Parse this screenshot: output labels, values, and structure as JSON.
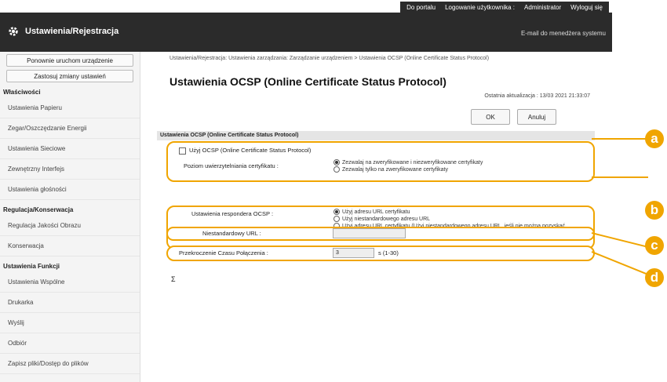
{
  "header": {
    "links": [
      "Do portalu",
      "Logowanie użytkownika :",
      "Administrator",
      "Wyloguj się"
    ],
    "title": "Ustawienia/Rejestracja",
    "mail": "E-mail do menedżera systemu"
  },
  "sidebar": {
    "buttons": [
      "Ponownie uruchom urządzenie",
      "Zastosuj zmiany ustawień"
    ],
    "sections": [
      {
        "head": "Właściwości",
        "items": [
          "Ustawienia Papieru",
          "Zegar/Oszczędzanie Energii",
          "Ustawienia Sieciowe",
          "Zewnętrzny Interfejs",
          "Ustawienia głośności"
        ]
      },
      {
        "head": "Regulacja/Konserwacja",
        "items": [
          "Regulacja Jakości Obrazu",
          "Konserwacja"
        ]
      },
      {
        "head": "Ustawienia Funkcji",
        "items": [
          "Ustawienia Wspólne",
          "Drukarka",
          "Wyślij",
          "Odbiór",
          "Zapisz pliki/Dostęp do plików"
        ]
      }
    ]
  },
  "main": {
    "breadcrumb": "Ustawienia/Rejestracja: Ustawienia zarządzania: Zarządzanie urządzeniem > Ustawienia OCSP (Online Certificate Status Protocol)",
    "title": "Ustawienia OCSP (Online Certificate Status Protocol)",
    "updated": "Ostatnia aktualizacja : 13/03 2021 21:33:07",
    "ok": "OK",
    "cancel": "Anuluj",
    "section": "Ustawienia OCSP (Online Certificate Status Protocol)",
    "use_ocsp": "Użyj OCSP (Online Certificate Status Protocol)",
    "cert_level_label": "Poziom uwierzytelniania certyfikatu :",
    "cert_level_opts": [
      "Zezwalaj na zweryfikowane i niezweryfikowane certyfikaty",
      "Zezwalaj tylko na zweryfikowane certyfikaty"
    ],
    "responder_label": "Ustawienia respondera OCSP :",
    "responder_opts": [
      "Użyj adresu URL certyfikatu",
      "Użyj niestandardowego adresu URL",
      "Użyj adresu URL certyfikatu (Użyj niestandardowego adresu URL, jeśli nie można pozyskać adresu URL certyfikatu)"
    ],
    "custom_url_label": "Niestandardowy URL :",
    "custom_url_value": "",
    "timeout_label": "Przekroczenie Czasu Połączenia :",
    "timeout_value": "3",
    "timeout_unit": "s (1-30)"
  },
  "callouts": [
    "a",
    "b",
    "c",
    "d"
  ],
  "colors": {
    "accent": "#f0a500",
    "header": "#2b2b2b"
  }
}
